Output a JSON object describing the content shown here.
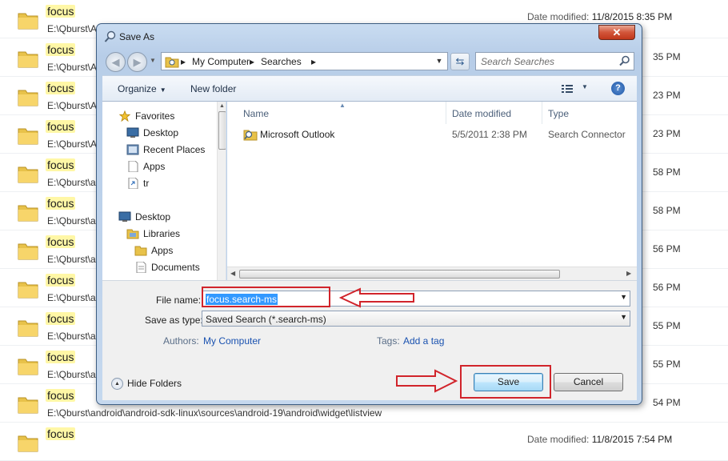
{
  "background_list": {
    "date_label": "Date modified:",
    "rows": [
      {
        "name": "focus",
        "path": "E:\\Qburst\\A",
        "date": "11/8/2015 8:35 PM",
        "time": ""
      },
      {
        "name": "focus",
        "path": "E:\\Qburst\\A",
        "date": "",
        "time": "35 PM"
      },
      {
        "name": "focus",
        "path": "E:\\Qburst\\A",
        "date": "",
        "time": "23 PM"
      },
      {
        "name": "focus",
        "path": "E:\\Qburst\\A",
        "date": "",
        "time": "23 PM"
      },
      {
        "name": "focus",
        "path": "E:\\Qburst\\a",
        "date": "",
        "time": "58 PM"
      },
      {
        "name": "focus",
        "path": "E:\\Qburst\\a",
        "date": "",
        "time": "58 PM"
      },
      {
        "name": "focus",
        "path": "E:\\Qburst\\a",
        "date": "",
        "time": "56 PM"
      },
      {
        "name": "focus",
        "path": "E:\\Qburst\\a",
        "date": "",
        "time": "56 PM"
      },
      {
        "name": "focus",
        "path": "E:\\Qburst\\a",
        "date": "",
        "time": "55 PM"
      },
      {
        "name": "focus",
        "path": "E:\\Qburst\\a",
        "date": "",
        "time": "55 PM"
      },
      {
        "name": "focus",
        "path": "E:\\Qburst\\android\\android-sdk-linux\\sources\\android-19\\android\\widget\\listview",
        "date": "",
        "time": "54 PM"
      },
      {
        "name": "focus",
        "path": "",
        "date": "11/8/2015 7:54 PM",
        "time": ""
      }
    ]
  },
  "dialog": {
    "title": "Save As",
    "close_label": "✕",
    "address": {
      "segments": [
        "My Computer",
        "Searches"
      ]
    },
    "search_placeholder": "Search Searches",
    "toolbar": {
      "organize": "Organize",
      "new_folder": "New folder",
      "help": "?"
    },
    "nav": {
      "favorites": "Favorites",
      "fav_items": [
        "Desktop",
        "Recent Places",
        "Apps",
        "tr"
      ],
      "desktop": "Desktop",
      "libraries": "Libraries",
      "lib_items": [
        "Apps",
        "Documents"
      ]
    },
    "columns": {
      "name": "Name",
      "date": "Date modified",
      "type": "Type"
    },
    "files": [
      {
        "name": "Microsoft Outlook",
        "date": "5/5/2011 2:38 PM",
        "type": "Search Connector"
      }
    ],
    "file_name_label": "File name:",
    "file_name_value": "focus.search-ms",
    "save_type_label": "Save as type:",
    "save_type_value": "Saved Search (*.search-ms)",
    "authors_label": "Authors:",
    "authors_value": "My Computer",
    "tags_label": "Tags:",
    "tags_value": "Add a tag",
    "hide_folders": "Hide Folders",
    "save_button": "Save",
    "cancel_button": "Cancel"
  },
  "colors": {
    "annotation": "#d1242b",
    "highlight": "#fff7a6",
    "selection": "#3399ff",
    "link": "#1a52b0"
  }
}
